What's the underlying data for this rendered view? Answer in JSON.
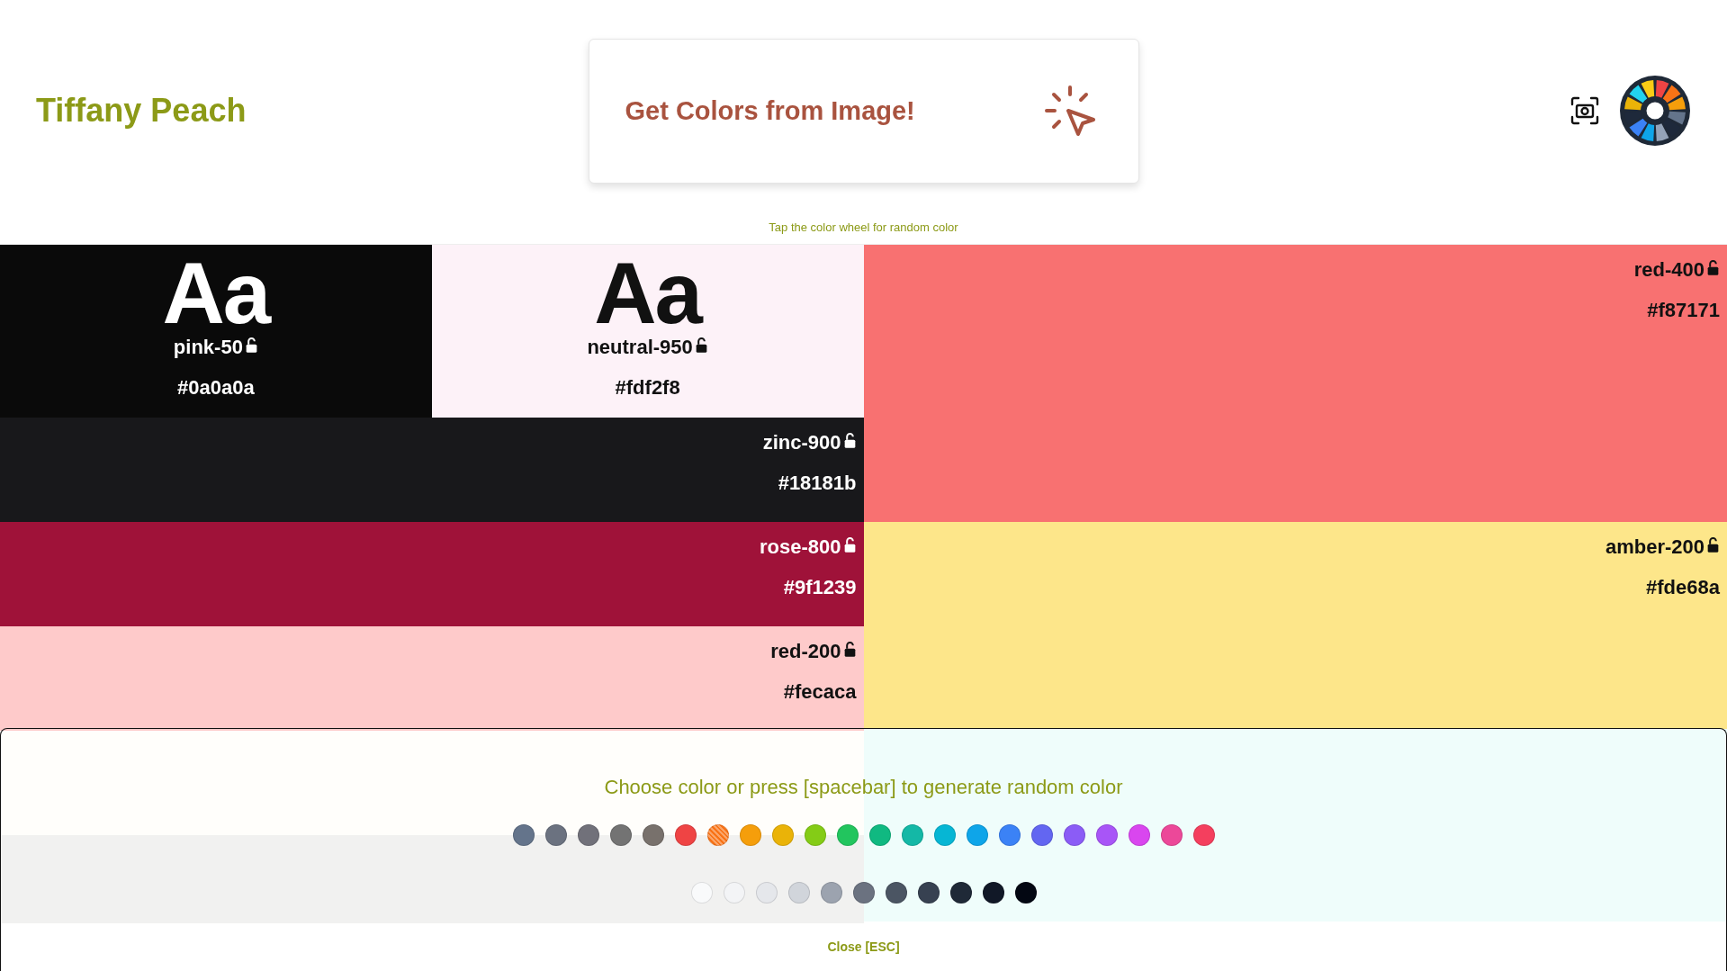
{
  "header": {
    "title": "Tiffany Peach",
    "image_button": "Get Colors from Image!",
    "hint": "Tap the color wheel for random color"
  },
  "columns": [
    {
      "rows": [
        {
          "tiles": [
            {
              "sample": "Aa",
              "name": "pink-50",
              "hex": "#0a0a0a",
              "color": "#0a0a0a",
              "locked": false
            },
            {
              "sample": "Aa",
              "name": "neutral-950",
              "hex": "#fdf2f8",
              "color": "#fdf2f8",
              "locked": false
            }
          ]
        },
        {
          "tiles": [
            {
              "name": "zinc-900",
              "hex": "#18181b",
              "color": "#18181b",
              "locked": false
            }
          ]
        },
        {
          "tiles": [
            {
              "name": "rose-800",
              "hex": "#9f1239",
              "color": "#9f1239",
              "locked": false
            }
          ]
        },
        {
          "tiles": [
            {
              "name": "red-200",
              "hex": "#fecaca",
              "color": "#fecaca",
              "locked": false
            }
          ]
        },
        {
          "tiles": [
            {
              "color": "#fffefb"
            }
          ]
        },
        {
          "tiles": [
            {
              "color": "#f1f1f0"
            }
          ]
        }
      ]
    },
    {
      "rows": [
        {
          "tiles": [
            {
              "name": "red-400",
              "hex": "#f87171",
              "color": "#f87171",
              "locked": false
            }
          ]
        },
        {
          "tiles": [
            {
              "name": "amber-200",
              "hex": "#fde68a",
              "color": "#fde68a",
              "locked": false
            }
          ]
        },
        {
          "tiles": [
            {
              "color": "#effdfb"
            }
          ]
        }
      ]
    }
  ],
  "picker": {
    "title": "Choose color or press [spacebar] to generate random color",
    "hues": [
      {
        "color": "#64748b",
        "selected": false
      },
      {
        "color": "#6b7280",
        "selected": false
      },
      {
        "color": "#71717a",
        "selected": false
      },
      {
        "color": "#737373",
        "selected": false
      },
      {
        "color": "#78716c",
        "selected": false
      },
      {
        "color": "#ef4444",
        "selected": false
      },
      {
        "color": "#f97316",
        "selected": true
      },
      {
        "color": "#f59e0b",
        "selected": false
      },
      {
        "color": "#eab308",
        "selected": false
      },
      {
        "color": "#84cc16",
        "selected": false
      },
      {
        "color": "#22c55e",
        "selected": false
      },
      {
        "color": "#10b981",
        "selected": false
      },
      {
        "color": "#14b8a6",
        "selected": false
      },
      {
        "color": "#06b6d4",
        "selected": false
      },
      {
        "color": "#0ea5e9",
        "selected": false
      },
      {
        "color": "#3b82f6",
        "selected": false
      },
      {
        "color": "#6366f1",
        "selected": false
      },
      {
        "color": "#8b5cf6",
        "selected": false
      },
      {
        "color": "#a855f7",
        "selected": false
      },
      {
        "color": "#d946ef",
        "selected": false
      },
      {
        "color": "#ec4899",
        "selected": false
      },
      {
        "color": "#f43f5e",
        "selected": false
      }
    ],
    "shades": [
      {
        "color": "#f9fafb"
      },
      {
        "color": "#f3f4f6"
      },
      {
        "color": "#e5e7eb"
      },
      {
        "color": "#d1d5db"
      },
      {
        "color": "#9ca3af"
      },
      {
        "color": "#6b7280"
      },
      {
        "color": "#4b5563"
      },
      {
        "color": "#374151"
      },
      {
        "color": "#1f2937"
      },
      {
        "color": "#111827"
      },
      {
        "color": "#030712"
      }
    ],
    "close": "Close [ESC]"
  }
}
